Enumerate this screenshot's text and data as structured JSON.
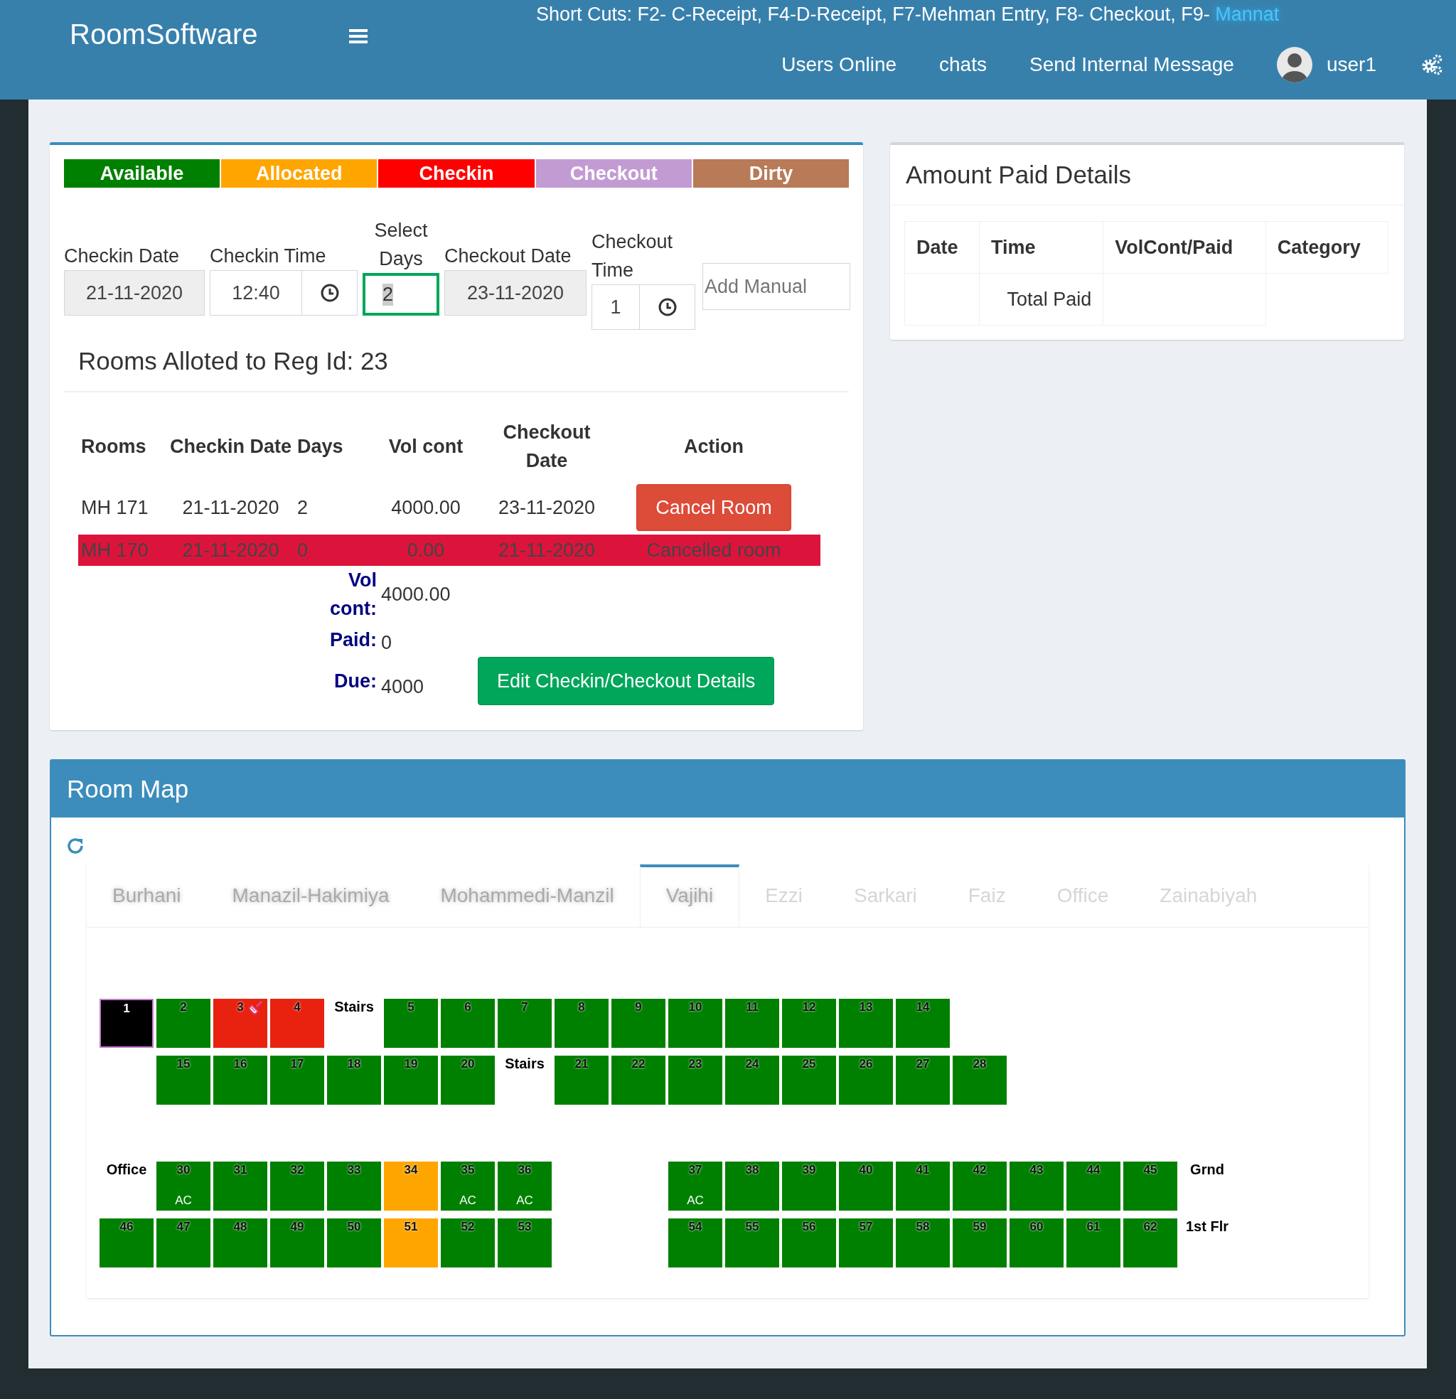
{
  "header": {
    "brand": "RoomSoftware",
    "shortcuts": "Short Cuts: F2- C-Receipt, F4-D-Receipt, F7-Mehman Entry, F8- Checkout, F9- ",
    "shortcut_link": "Mannat",
    "nav": [
      "Users Online",
      "chats",
      "Send Internal Message"
    ],
    "user": "user1"
  },
  "legend": [
    {
      "label": "Available",
      "color": "#008000"
    },
    {
      "label": "Allocated",
      "color": "#ffa500"
    },
    {
      "label": "Checkin",
      "color": "#ff0000"
    },
    {
      "label": "Checkout",
      "color": "#c39bd3"
    },
    {
      "label": "Dirty",
      "color": "#b87a57"
    }
  ],
  "form": {
    "checkin_date": {
      "label": "Checkin Date",
      "value": "21-11-2020"
    },
    "checkin_time": {
      "label": "Checkin Time",
      "value": "12:40"
    },
    "select_days": {
      "label": "Select Days",
      "value": "2"
    },
    "checkout_date": {
      "label": "Checkout Date",
      "value": "23-11-2020"
    },
    "checkout_time": {
      "label": "Checkout Time",
      "value": "1"
    },
    "add_manual": {
      "placeholder": "Add Manual"
    }
  },
  "allotment": {
    "title": "Rooms Alloted to Reg Id: 23",
    "columns": [
      "Rooms",
      "Checkin Date",
      "Days",
      "Vol cont",
      "Checkout Date",
      "Action"
    ],
    "rows": [
      {
        "cancelled": false,
        "cells": [
          "MH 171",
          "21-11-2020",
          "2",
          "4000.00",
          "23-11-2020"
        ],
        "action": "Cancel Room"
      },
      {
        "cancelled": true,
        "cells": [
          "MH 170",
          "21-11-2020",
          "0",
          "0.00",
          "21-11-2020"
        ],
        "action": "Cancelled room"
      }
    ],
    "totals": [
      {
        "label": "Vol cont:",
        "value": "4000.00"
      },
      {
        "label": "Paid:",
        "value": "0"
      },
      {
        "label": "Due:",
        "value": "4000"
      }
    ],
    "edit_button": "Edit Checkin/Checkout Details"
  },
  "amount_paid": {
    "title": "Amount Paid Details",
    "columns": [
      "Date",
      "Time",
      "VolCont/Paid",
      "Category"
    ],
    "total_label": "Total Paid"
  },
  "room_map": {
    "title": "Room Map",
    "tabs": [
      {
        "label": "Burhani",
        "selected": false,
        "faded": false
      },
      {
        "label": "Manazil-Hakimiya",
        "selected": false,
        "faded": false
      },
      {
        "label": "Mohammedi-Manzil",
        "selected": false,
        "faded": false
      },
      {
        "label": "Vajihi",
        "selected": true,
        "faded": false
      },
      {
        "label": "Ezzi",
        "selected": false,
        "faded": true
      },
      {
        "label": "Sarkari",
        "selected": false,
        "faded": true
      },
      {
        "label": "Faiz",
        "selected": false,
        "faded": true
      },
      {
        "label": "Office",
        "selected": false,
        "faded": true
      },
      {
        "label": "Zainabiyah",
        "selected": false,
        "faded": true
      }
    ],
    "sections": [
      {
        "rows": [
          [
            {
              "kind": "room",
              "number": "1",
              "color": "#000000",
              "selected": true,
              "broom": false
            },
            {
              "kind": "room",
              "number": "2",
              "color": "#008000",
              "selected": false,
              "broom": false
            },
            {
              "kind": "room",
              "number": "3",
              "color": "#e8220f",
              "selected": false,
              "broom": true
            },
            {
              "kind": "room",
              "number": "4",
              "color": "#e8220f",
              "selected": false,
              "broom": false
            },
            {
              "kind": "label",
              "text": "Stairs"
            },
            {
              "kind": "room",
              "number": "5",
              "color": "#008000",
              "selected": false,
              "broom": false
            },
            {
              "kind": "room",
              "number": "6",
              "color": "#008000",
              "selected": false,
              "broom": false
            },
            {
              "kind": "room",
              "number": "7",
              "color": "#008000",
              "selected": false,
              "broom": false
            },
            {
              "kind": "room",
              "number": "8",
              "color": "#008000",
              "selected": false,
              "broom": false
            },
            {
              "kind": "room",
              "number": "9",
              "color": "#008000",
              "selected": false,
              "broom": false
            },
            {
              "kind": "room",
              "number": "10",
              "color": "#008000",
              "selected": false,
              "broom": false
            },
            {
              "kind": "room",
              "number": "11",
              "color": "#008000",
              "selected": false,
              "broom": false
            },
            {
              "kind": "room",
              "number": "12",
              "color": "#008000",
              "selected": false,
              "broom": false
            },
            {
              "kind": "room",
              "number": "13",
              "color": "#008000",
              "selected": false,
              "broom": false
            },
            {
              "kind": "room",
              "number": "14",
              "color": "#008000",
              "selected": false,
              "broom": false
            }
          ],
          [
            {
              "kind": "blank"
            },
            {
              "kind": "room",
              "number": "15",
              "color": "#008000",
              "selected": false,
              "broom": false
            },
            {
              "kind": "room",
              "number": "16",
              "color": "#008000",
              "selected": false,
              "broom": false
            },
            {
              "kind": "room",
              "number": "17",
              "color": "#008000",
              "selected": false,
              "broom": false
            },
            {
              "kind": "room",
              "number": "18",
              "color": "#008000",
              "selected": false,
              "broom": false
            },
            {
              "kind": "room",
              "number": "19",
              "color": "#008000",
              "selected": false,
              "broom": false
            },
            {
              "kind": "room",
              "number": "20",
              "color": "#008000",
              "selected": false,
              "broom": false
            },
            {
              "kind": "label",
              "text": "Stairs"
            },
            {
              "kind": "room",
              "number": "21",
              "color": "#008000",
              "selected": false,
              "broom": false
            },
            {
              "kind": "room",
              "number": "22",
              "color": "#008000",
              "selected": false,
              "broom": false
            },
            {
              "kind": "room",
              "number": "23",
              "color": "#008000",
              "selected": false,
              "broom": false
            },
            {
              "kind": "room",
              "number": "24",
              "color": "#008000",
              "selected": false,
              "broom": false
            },
            {
              "kind": "room",
              "number": "25",
              "color": "#008000",
              "selected": false,
              "broom": false
            },
            {
              "kind": "room",
              "number": "26",
              "color": "#008000",
              "selected": false,
              "broom": false
            },
            {
              "kind": "room",
              "number": "27",
              "color": "#008000",
              "selected": false,
              "broom": false
            },
            {
              "kind": "room",
              "number": "28",
              "color": "#008000",
              "selected": false,
              "broom": false
            }
          ]
        ]
      },
      {
        "rows": [
          [
            {
              "kind": "label",
              "text": "Office"
            },
            {
              "kind": "room",
              "number": "30",
              "tag": "AC",
              "color": "#008000",
              "selected": false,
              "broom": false
            },
            {
              "kind": "room",
              "number": "31",
              "color": "#008000",
              "selected": false,
              "broom": false
            },
            {
              "kind": "room",
              "number": "32",
              "color": "#008000",
              "selected": false,
              "broom": false
            },
            {
              "kind": "room",
              "number": "33",
              "color": "#008000",
              "selected": false,
              "broom": false
            },
            {
              "kind": "room",
              "number": "34",
              "color": "#ffa500",
              "selected": false,
              "broom": false
            },
            {
              "kind": "room",
              "number": "35",
              "tag": "AC",
              "color": "#008000",
              "selected": false,
              "broom": false
            },
            {
              "kind": "room",
              "number": "36",
              "tag": "AC",
              "color": "#008000",
              "selected": false,
              "broom": false
            },
            {
              "kind": "blank"
            },
            {
              "kind": "blank"
            },
            {
              "kind": "room",
              "number": "37",
              "tag": "AC",
              "color": "#008000",
              "selected": false,
              "broom": false
            },
            {
              "kind": "room",
              "number": "38",
              "color": "#008000",
              "selected": false,
              "broom": false
            },
            {
              "kind": "room",
              "number": "39",
              "color": "#008000",
              "selected": false,
              "broom": false
            },
            {
              "kind": "room",
              "number": "40",
              "color": "#008000",
              "selected": false,
              "broom": false
            },
            {
              "kind": "room",
              "number": "41",
              "color": "#008000",
              "selected": false,
              "broom": false
            },
            {
              "kind": "room",
              "number": "42",
              "color": "#008000",
              "selected": false,
              "broom": false
            },
            {
              "kind": "room",
              "number": "43",
              "color": "#008000",
              "selected": false,
              "broom": false
            },
            {
              "kind": "room",
              "number": "44",
              "color": "#008000",
              "selected": false,
              "broom": false
            },
            {
              "kind": "room",
              "number": "45",
              "color": "#008000",
              "selected": false,
              "broom": false
            },
            {
              "kind": "label",
              "text": "Grnd"
            }
          ],
          [
            {
              "kind": "room",
              "number": "46",
              "color": "#008000",
              "selected": false,
              "broom": false
            },
            {
              "kind": "room",
              "number": "47",
              "color": "#008000",
              "selected": false,
              "broom": false
            },
            {
              "kind": "room",
              "number": "48",
              "color": "#008000",
              "selected": false,
              "broom": false
            },
            {
              "kind": "room",
              "number": "49",
              "color": "#008000",
              "selected": false,
              "broom": false
            },
            {
              "kind": "room",
              "number": "50",
              "color": "#008000",
              "selected": false,
              "broom": false
            },
            {
              "kind": "room",
              "number": "51",
              "color": "#ffa500",
              "selected": false,
              "broom": false
            },
            {
              "kind": "room",
              "number": "52",
              "color": "#008000",
              "selected": false,
              "broom": false
            },
            {
              "kind": "room",
              "number": "53",
              "color": "#008000",
              "selected": false,
              "broom": false
            },
            {
              "kind": "blank"
            },
            {
              "kind": "blank"
            },
            {
              "kind": "room",
              "number": "54",
              "color": "#008000",
              "selected": false,
              "broom": false
            },
            {
              "kind": "room",
              "number": "55",
              "color": "#008000",
              "selected": false,
              "broom": false
            },
            {
              "kind": "room",
              "number": "56",
              "color": "#008000",
              "selected": false,
              "broom": false
            },
            {
              "kind": "room",
              "number": "57",
              "color": "#008000",
              "selected": false,
              "broom": false
            },
            {
              "kind": "room",
              "number": "58",
              "color": "#008000",
              "selected": false,
              "broom": false
            },
            {
              "kind": "room",
              "number": "59",
              "color": "#008000",
              "selected": false,
              "broom": false
            },
            {
              "kind": "room",
              "number": "60",
              "color": "#008000",
              "selected": false,
              "broom": false
            },
            {
              "kind": "room",
              "number": "61",
              "color": "#008000",
              "selected": false,
              "broom": false
            },
            {
              "kind": "room",
              "number": "62",
              "color": "#008000",
              "selected": false,
              "broom": false
            },
            {
              "kind": "label",
              "text": "1st Flr"
            }
          ]
        ]
      }
    ]
  }
}
